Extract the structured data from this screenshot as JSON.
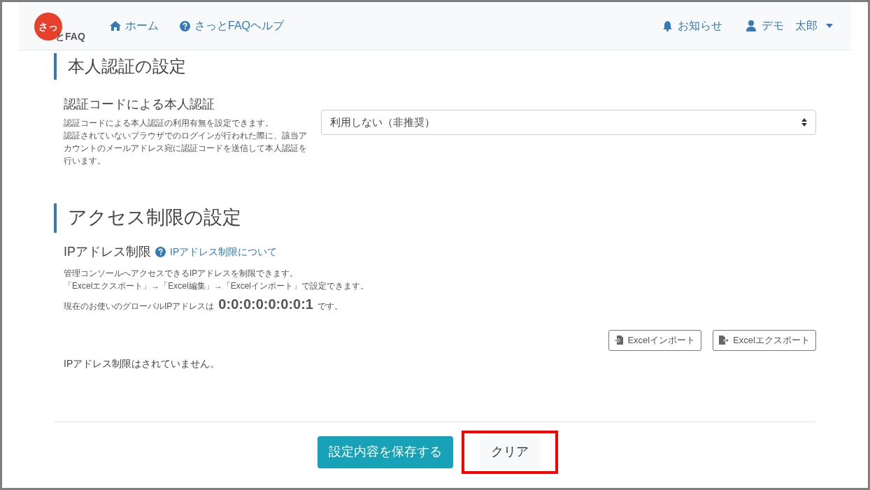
{
  "navbar": {
    "logo": {
      "mark": "さっ",
      "text": "とFAQ"
    },
    "links": [
      {
        "kind": "home",
        "label": "ホーム"
      },
      {
        "kind": "help",
        "label": "さっとFAQヘルプ"
      }
    ],
    "right": [
      {
        "kind": "bell",
        "label": "お知らせ",
        "dropdown": false
      },
      {
        "kind": "user",
        "label": "デモ　太郎",
        "dropdown": true
      }
    ]
  },
  "auth_section": {
    "title": "本人認証の設定",
    "setting": {
      "label": "認証コードによる本人認証",
      "description": [
        "認証コードによる本人認証の利用有無を設定できます。",
        "認証されていないブラウザでのログインが行われた際に、該当アカウントのメールアドレス宛に認証コードを送信して本人認証を行います。"
      ],
      "select_value": "利用しない（非推奨）"
    }
  },
  "access_section": {
    "title": "アクセス制限の設定",
    "ip": {
      "label": "IPアドレス制限",
      "help_link": "IPアドレス制限について",
      "description": [
        "管理コンソールへアクセスできるIPアドレスを制限できます。",
        "「Excelエクスポート」→「Excel編集」→「Excelインポート」で設定できます。"
      ],
      "current_prefix": "現在のお使いのグローバルIPアドレスは",
      "current_ip": "0:0:0:0:0:0:0:1",
      "current_suffix": "です。",
      "buttons": [
        {
          "kind": "import",
          "label": "Excelインポート"
        },
        {
          "kind": "export",
          "label": "Excelエクスポート"
        }
      ],
      "status": "IPアドレス制限はされていません。"
    }
  },
  "footer_buttons": [
    {
      "kind": "primary",
      "label": "設定内容を保存する",
      "highlighted": false
    },
    {
      "kind": "light",
      "label": "クリア",
      "highlighted": true
    }
  ]
}
